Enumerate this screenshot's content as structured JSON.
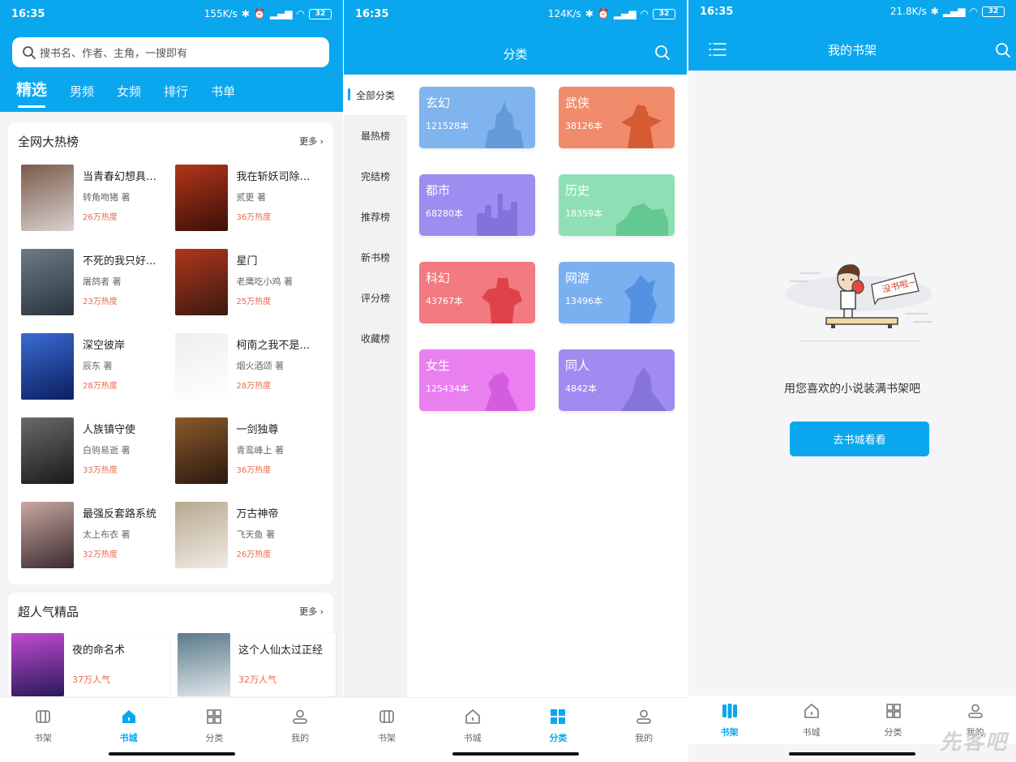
{
  "screen1": {
    "status": {
      "time": "16:35",
      "speed": "155K/s",
      "battery": "32"
    },
    "search_placeholder": "搜书名、作者、主角，一搜即有",
    "tabs": [
      {
        "label": "精选",
        "active": true
      },
      {
        "label": "男频"
      },
      {
        "label": "女频"
      },
      {
        "label": "排行"
      },
      {
        "label": "书单"
      }
    ],
    "section1": {
      "title": "全网大热榜",
      "more": "更多",
      "books": [
        {
          "name": "当青春幻想具现...",
          "author": "转角吻猪 著",
          "heat": "26万热度",
          "color1": "#d9d2cf",
          "color2": "#7a5a4a"
        },
        {
          "name": "我在斩妖司除魔...",
          "author": "贰更 著",
          "heat": "36万热度",
          "color1": "#3a0f08",
          "color2": "#b3361a"
        },
        {
          "name": "不死的我只好...",
          "author": "屠鸽者 著",
          "heat": "23万热度",
          "color1": "#2a3440",
          "color2": "#6d7b86"
        },
        {
          "name": "星门",
          "author": "老鹰吃小鸡 著",
          "heat": "25万热度",
          "color1": "#3a1a10",
          "color2": "#b0361c"
        },
        {
          "name": "深空彼岸",
          "author": "辰东 著",
          "heat": "28万热度",
          "color1": "#0b1f5e",
          "color2": "#3a6bd4"
        },
        {
          "name": "柯南之我不是...",
          "author": "烟火酒颂 著",
          "heat": "28万热度",
          "color1": "#ffffff",
          "color2": "#eeeeee"
        },
        {
          "name": "人族镇守使",
          "author": "白驹易逝 著",
          "heat": "33万热度",
          "color1": "#1a1a1a",
          "color2": "#6a6a6a"
        },
        {
          "name": "一剑独尊",
          "author": "青鸾峰上 著",
          "heat": "36万热度",
          "color1": "#2a1810",
          "color2": "#8a5a2a"
        },
        {
          "name": "最强反套路系统",
          "author": "太上布衣 著",
          "heat": "32万热度",
          "color1": "#3a2a30",
          "color2": "#c8a8a0"
        },
        {
          "name": "万古神帝",
          "author": "飞天鱼 著",
          "heat": "26万热度",
          "color1": "#f0ece4",
          "color2": "#b8a890"
        }
      ]
    },
    "section2": {
      "title": "超人气精品",
      "more": "更多",
      "books": [
        {
          "name": "夜的命名术",
          "heat": "37万人气",
          "color1": "#2a1a5a",
          "color2": "#c04ad0"
        },
        {
          "name": "这个人仙太过正经",
          "heat": "32万人气",
          "color1": "#dfe6ea",
          "color2": "#5a7a8a"
        }
      ]
    },
    "tabbar": [
      {
        "label": "书架",
        "icon": "bookshelf-icon"
      },
      {
        "label": "书城",
        "icon": "home-icon",
        "active": true
      },
      {
        "label": "分类",
        "icon": "category-icon"
      },
      {
        "label": "我的",
        "icon": "profile-icon"
      }
    ]
  },
  "screen2": {
    "status": {
      "time": "16:35",
      "speed": "124K/s",
      "battery": "32"
    },
    "title": "分类",
    "sidebar": [
      {
        "label": "全部分类",
        "active": true
      },
      {
        "label": "最热榜"
      },
      {
        "label": "完结榜"
      },
      {
        "label": "推荐榜"
      },
      {
        "label": "新书榜"
      },
      {
        "label": "评分榜"
      },
      {
        "label": "收藏榜"
      }
    ],
    "categories": [
      {
        "name": "玄幻",
        "count": "121528本",
        "color": "#7fb4ee",
        "dark": "#5f97d6"
      },
      {
        "name": "武侠",
        "count": "38126本",
        "color": "#f08c6c",
        "dark": "#d0532a"
      },
      {
        "name": "都市",
        "count": "68280本",
        "color": "#9c8ef0",
        "dark": "#7d6fd8"
      },
      {
        "name": "历史",
        "count": "18359本",
        "color": "#8ee0b4",
        "dark": "#5cc48c"
      },
      {
        "name": "科幻",
        "count": "43767本",
        "color": "#f27a80",
        "dark": "#dc3a40"
      },
      {
        "name": "网游",
        "count": "13496本",
        "color": "#7ab0f0",
        "dark": "#4e8cde"
      },
      {
        "name": "女生",
        "count": "125434本",
        "color": "#ea80f0",
        "dark": "#d058dc"
      },
      {
        "name": "同人",
        "count": "4842本",
        "color": "#a08cf0",
        "dark": "#8270d8"
      }
    ],
    "tabbar": [
      {
        "label": "书架",
        "icon": "bookshelf-icon"
      },
      {
        "label": "书城",
        "icon": "home-icon"
      },
      {
        "label": "分类",
        "icon": "category-icon",
        "active": true
      },
      {
        "label": "我的",
        "icon": "profile-icon"
      }
    ]
  },
  "screen3": {
    "status": {
      "time": "16:35",
      "speed": "21.8K/s",
      "battery": "32"
    },
    "title": "我的书架",
    "bubble_text": "没书啦~",
    "empty_text": "用您喜欢的小说装满书架吧",
    "button": "去书城看看",
    "tabbar": [
      {
        "label": "书架",
        "icon": "bookshelf-icon",
        "active": true
      },
      {
        "label": "书城",
        "icon": "home-icon"
      },
      {
        "label": "分类",
        "icon": "category-icon"
      },
      {
        "label": "我的",
        "icon": "profile-icon"
      }
    ],
    "watermark": "先客吧"
  },
  "colors": {
    "accent": "#0aa7ef",
    "heat": "#e86a4a"
  }
}
